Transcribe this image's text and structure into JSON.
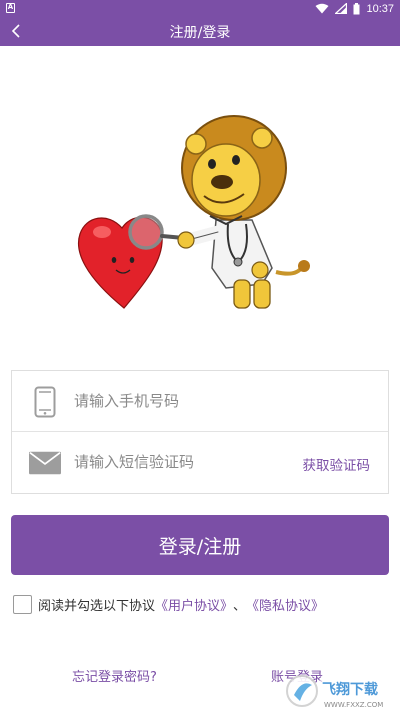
{
  "status_bar": {
    "time": "10:37",
    "app_icon": "A"
  },
  "app_bar": {
    "title": "注册/登录"
  },
  "form": {
    "phone_placeholder": "请输入手机号码",
    "code_placeholder": "请输入短信验证码",
    "get_code_label": "获取验证码"
  },
  "login_button": "登录/注册",
  "agreement": {
    "text": "阅读并勾选以下协议",
    "user_agreement": "《用户协议》",
    "separator": "、",
    "privacy_agreement": "《隐私协议》",
    "checked": false
  },
  "links": {
    "forgot_password": "忘记登录密码?",
    "account_login": "账号登录"
  },
  "watermark": {
    "brand": "飞翔下载",
    "url": "WWW.FXXZ.COM"
  },
  "icons": {
    "back": "chevron-left-icon",
    "phone": "phone-icon",
    "mail": "envelope-icon",
    "wifi": "wifi-icon",
    "signal": "signal-icon",
    "battery": "battery-icon"
  },
  "colors": {
    "primary": "#7b4fa6",
    "placeholder": "#8a8a8a"
  }
}
